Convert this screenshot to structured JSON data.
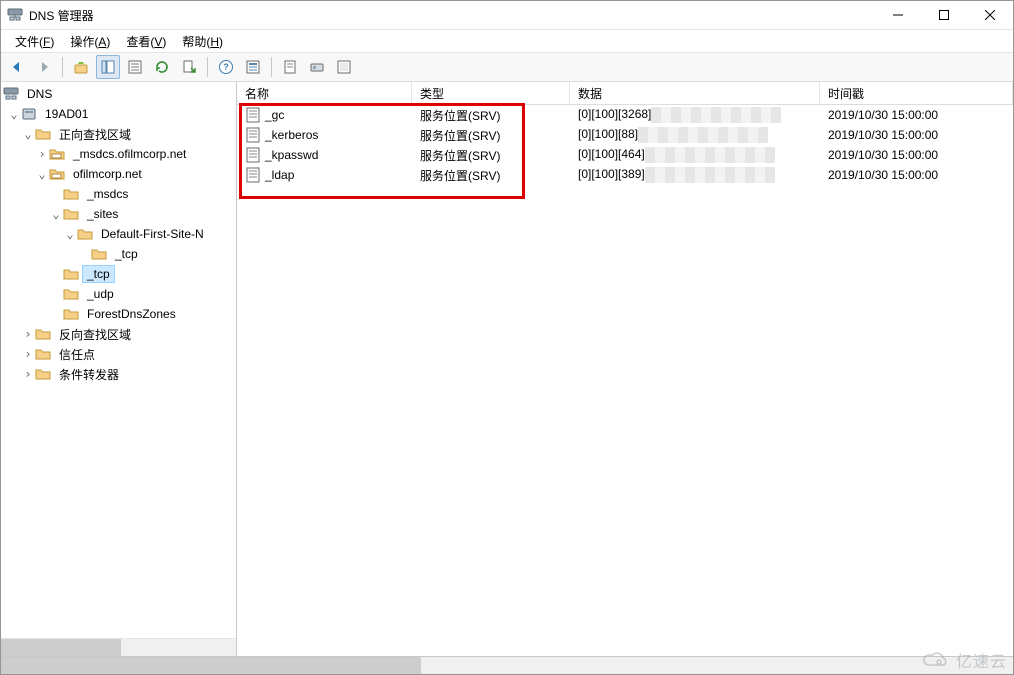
{
  "window": {
    "title": "DNS 管理器"
  },
  "menu": {
    "file": {
      "before": "文件(",
      "key": "F",
      "after": ")"
    },
    "action": {
      "before": "操作(",
      "key": "A",
      "after": ")"
    },
    "view": {
      "before": "查看(",
      "key": "V",
      "after": ")"
    },
    "help": {
      "before": "帮助(",
      "key": "H",
      "after": ")"
    }
  },
  "tree": {
    "root": "DNS",
    "server": "19AD01",
    "fwd_zones": "正向查找区域",
    "zone_msdcs": "_msdcs.ofilmcorp.net",
    "zone_main": "ofilmcorp.net",
    "n_msdcs": "_msdcs",
    "n_sites": "_sites",
    "n_default_site": "Default-First-Site-N",
    "n_tcp_inner": "_tcp",
    "n_tcp": "_tcp",
    "n_udp": "_udp",
    "n_forestdns": "ForestDnsZones",
    "rev_zones": "反向查找区域",
    "trust": "信任点",
    "fwd": "条件转发器"
  },
  "columns": {
    "name": "名称",
    "type": "类型",
    "data": "数据",
    "ts": "时间戳"
  },
  "rows": [
    {
      "name": "_gc",
      "type": "服务位置(SRV)",
      "data": "[0][100][3268]",
      "ts": "2019/10/30 15:00:00"
    },
    {
      "name": "_kerberos",
      "type": "服务位置(SRV)",
      "data": "[0][100][88]",
      "ts": "2019/10/30 15:00:00"
    },
    {
      "name": "_kpasswd",
      "type": "服务位置(SRV)",
      "data": "[0][100][464]",
      "ts": "2019/10/30 15:00:00"
    },
    {
      "name": "_ldap",
      "type": "服务位置(SRV)",
      "data": "[0][100][389]",
      "ts": "2019/10/30 15:00:00"
    }
  ],
  "watermark": "亿速云"
}
